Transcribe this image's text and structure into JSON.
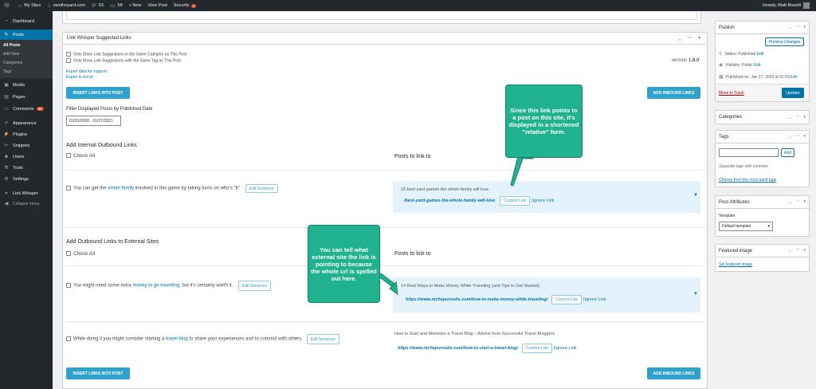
{
  "adminbar": {
    "items": [
      "My Sites",
      "owntheyard.com",
      "63",
      "58",
      "+ New",
      "View Post",
      "Security"
    ],
    "security_badge": "2",
    "howdy": "Howdy, Matt Bissett"
  },
  "sidebar": {
    "dashboard": "Dashboard",
    "posts": "Posts",
    "posts_sub": [
      "All Posts",
      "Add New",
      "Categories",
      "Tags"
    ],
    "media": "Media",
    "pages": "Pages",
    "comments": "Comments",
    "comments_count": "58",
    "appearance": "Appearance",
    "plugins": "Plugins",
    "snippets": "Snippets",
    "users": "Users",
    "tools": "Tools",
    "settings": "Settings",
    "link_whisper": "Link Whisper",
    "collapse": "Collapse menu"
  },
  "linkwhisper": {
    "title": "Link Whisper Suggested Links",
    "opt_category": "Only Show Link Suggestions in the Same Category as This Post",
    "opt_tag": "Only Show Link Suggestions with the Same Tag as This Post",
    "version_label": "version",
    "version": "1.8.0",
    "export_support": "Export data for support",
    "export_excel": "Export to Excel",
    "insert_btn": "INSERT LINKS INTO POST",
    "add_inbound_btn": "ADD INBOUND LINKS",
    "filter_label": "Filter Displayed Posts by Published Date",
    "date_range": "01/01/2000 - 01/27/2021",
    "internal_title": "Add Internal Outbound Links",
    "external_title": "Add Outbound Links to External Sites",
    "check_all": "Check All",
    "posts_to_link": "Posts to link to",
    "edit_sentence": "Edit Sentence",
    "custom_link": "Custom Link",
    "ignore_link": "Ignore Link",
    "internal_rows": [
      {
        "pre": "You can get the ",
        "anchor": "whole family",
        "post": " involved in this game by taking turns on who's \"It\"",
        "target_title": "15 best yard games the whole family will love",
        "target_url": "/best-yard-games-the-whole-family-will-love"
      }
    ],
    "external_rows": [
      {
        "pre": "You might need some extra ",
        "anchor": "money to go travelling",
        "post": ", but it's certainly worth it.",
        "target_title": "14 Real Ways to Make Money While Traveling (and Tips to Get Started)",
        "target_url": "https://www.nichepursuits.com/how-to-make-money-while-traveling/"
      },
      {
        "pre": "While doing it you might consider starting a ",
        "anchor": "travel blog",
        "post": " to share your experiences and to connect with others",
        "target_title": "How to Start and Monetize a Travel Blog – Advice from Successful Travel Bloggers",
        "target_url": "https://www.nichepursuits.com/how-to-start-a-travel-blog/"
      }
    ]
  },
  "callouts": {
    "relative": "Since this link points to a post on this site, it's displayed in a shortened \"relative\" form.",
    "external": "You can tell what external site the link is pointing to because the whole url is spelled out here."
  },
  "publish": {
    "title": "Publish",
    "preview": "Preview Changes",
    "status": "Status: Published",
    "visibility": "Visibility: Public",
    "published_on": "Published on: Jan 27, 2020 at 01:59",
    "edit": "Edit",
    "trash": "Move to Trash",
    "update": "Update"
  },
  "categories_box": {
    "title": "Categories"
  },
  "tags_box": {
    "title": "Tags",
    "add": "Add",
    "hint": "Separate tags with commas",
    "choose": "Choose from the most used tags"
  },
  "attributes_box": {
    "title": "Post Attributes",
    "template_label": "Template",
    "template_value": "Default template"
  },
  "featured_box": {
    "title": "Featured image",
    "set": "Set featured image"
  },
  "colors": {
    "accent_blue": "#2ea2cc",
    "callout_green": "#20b28e",
    "wp_dark": "#23282d",
    "wp_active": "#0073aa"
  }
}
